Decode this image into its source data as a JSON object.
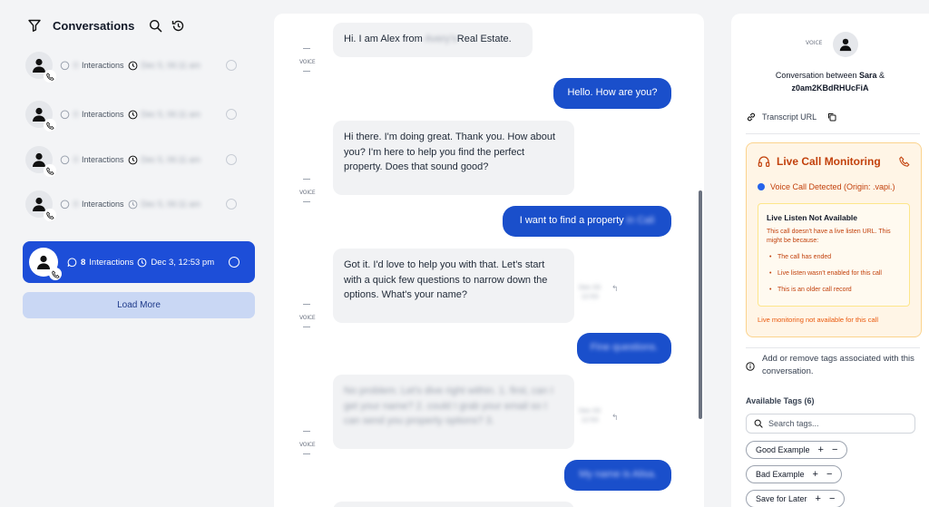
{
  "left": {
    "title": "Conversations",
    "items": [
      {
        "count": "0",
        "interactions_label": "Interactions",
        "timestamp": "Dec 5, 06:11 am"
      },
      {
        "count": "0",
        "interactions_label": "Interactions",
        "timestamp": "Dec 5, 06:11 am"
      },
      {
        "count": "0",
        "interactions_label": "Interactions",
        "timestamp": "Dec 5, 06:11 am"
      },
      {
        "count": "0",
        "interactions_label": "Interactions",
        "timestamp": "Dec 5, 06:11 am"
      }
    ],
    "selected": {
      "count": "8",
      "interactions_label": "Interactions",
      "timestamp": "Dec 3, 12:53 pm"
    },
    "load_more": "Load More"
  },
  "chat": {
    "messages": [
      {
        "role": "agent",
        "pre": "Hi. I am Alex from",
        "blurred": "Avery's",
        "post": "Real Estate."
      },
      {
        "role": "user",
        "text": "Hello. How are you?"
      },
      {
        "role": "agent",
        "text": "Hi there. I'm doing great. Thank you. How about you? I'm here to help you find the perfect property. Does that sound good?"
      },
      {
        "role": "user",
        "pre": "I want to find a property",
        "blurred": "in Cali"
      },
      {
        "role": "agent",
        "text": "Got it. I'd love to help you with that. Let's start with a quick few questions to narrow down the options. What's your name?",
        "time": "Dec 03\n12:53"
      },
      {
        "role": "user",
        "blurred": "Fine questions."
      },
      {
        "role": "agent",
        "blurred": "No problem. Let's dive right within. 1. first, can I get your name? 2. could I grab your email so I can send you property options? 3.",
        "time": "Dec 03\n12:53"
      },
      {
        "role": "user",
        "blurred": "My name is Alisa."
      }
    ]
  },
  "right": {
    "conv_between_prefix": "Conversation between",
    "user_name": "Sara",
    "amp": "&",
    "conv_id": "z0am2KBdRHUcFiA",
    "transcript_label": "Transcript URL",
    "live": {
      "title": "Live Call Monitoring",
      "voice_detected": "Voice Call Detected (Origin: .vapi.)",
      "not_available_title": "Live Listen Not Available",
      "not_available_desc": "This call doesn't have a live listen URL. This might be because:",
      "reasons": [
        "The call has ended",
        "Live listen wasn't enabled for this call",
        "This is an older call record"
      ],
      "footer": "Live monitoring not available for this call"
    },
    "tags_info": "Add or remove tags associated with this conversation.",
    "available_tags": "Available Tags (6)",
    "search_placeholder": "Search tags...",
    "tags": [
      "Good Example",
      "Bad Example",
      "Save for Later"
    ],
    "add_symbol": "+",
    "remove_symbol": "−"
  },
  "colors": {
    "accent": "#1a4fcb",
    "warning": "#c2410c",
    "warning_bg": "#fff5e6"
  }
}
